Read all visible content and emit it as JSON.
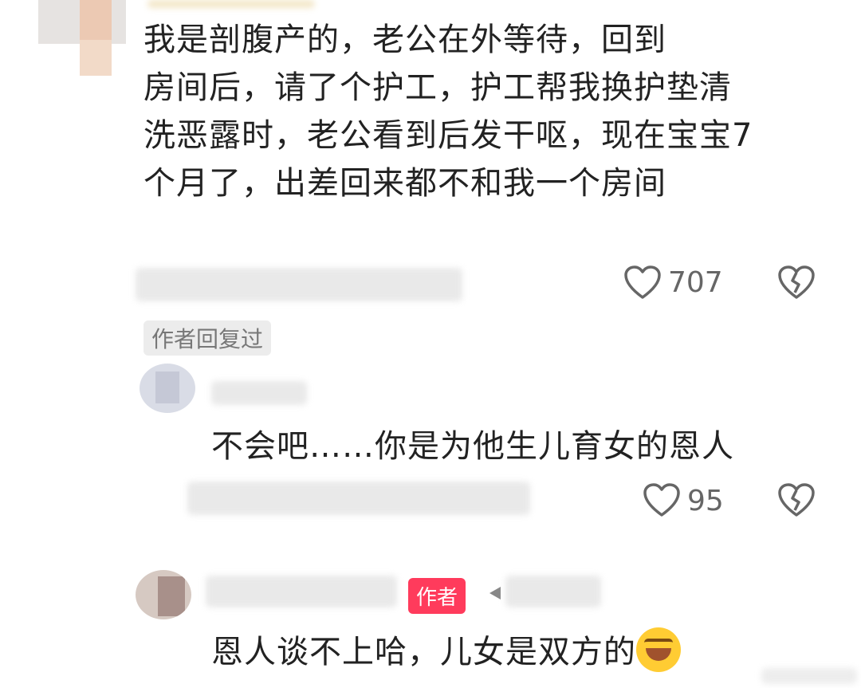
{
  "main_comment": {
    "lines": [
      "我是剖腹产的，老公在外等待，回到",
      "房间后，请了个护工，护工帮我换护垫清",
      "洗恶露时，老公看到后发干呕，现在宝宝7",
      "个月了，出差回来都不和我一个房间"
    ],
    "likes": "707",
    "reply_badge": "作者回复过"
  },
  "reply_1": {
    "text": "不会吧……你是为他生儿育女的恩人",
    "likes": "95"
  },
  "reply_2": {
    "author_badge": "作者",
    "text": "恩人谈不上哈，儿女是双方的"
  },
  "icons": {
    "like": "heart-outline-icon",
    "dislike": "broken-heart-icon",
    "emoji": "rofl-emoji-icon"
  },
  "colors": {
    "author_badge": "#ff3b5c",
    "text": "#222222",
    "secondary": "#666666"
  }
}
